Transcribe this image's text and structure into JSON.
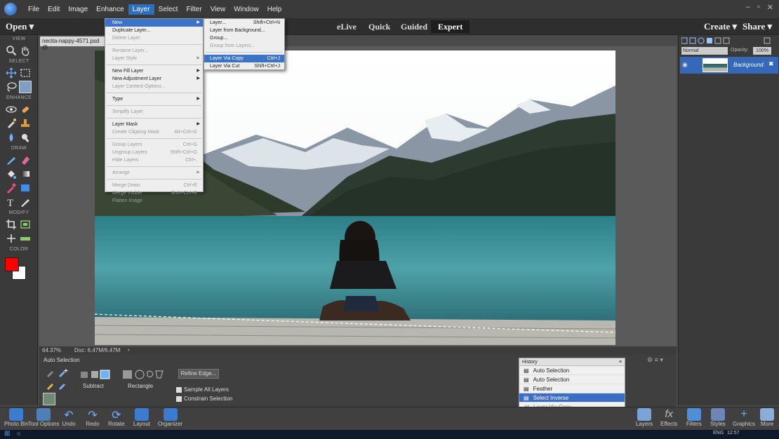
{
  "menubar": {
    "items": [
      "File",
      "Edit",
      "Image",
      "Enhance",
      "Layer",
      "Select",
      "Filter",
      "View",
      "Window",
      "Help"
    ],
    "active": "Layer"
  },
  "modebar": {
    "open": "Open",
    "tabs": [
      "eLive",
      "Quick",
      "Guided",
      "Expert"
    ],
    "active_tab": "Expert",
    "create": "Create",
    "share": "Share"
  },
  "toolbox": {
    "sections": [
      "VIEW",
      "SELECT",
      "ENHANCE",
      "DRAW",
      "MODIFY",
      "COLOR"
    ],
    "foreground_color": "#ff0000",
    "background_color": "#ffffff"
  },
  "document": {
    "tab_title": "necita-nappy-4571.psd @"
  },
  "status": {
    "zoom": "64.37%",
    "doc_size": "Doc: 6.47M/6.47M"
  },
  "tool_options": {
    "tool_name": "Auto Selection",
    "subtract_label": "Subtract",
    "rectangle_label": "Rectangle",
    "refine_edge": "Refine Edge...",
    "sample_all_layers": "Sample All Layers",
    "constrain_selection": "Constrain Selection"
  },
  "layers_panel": {
    "blend_mode": "Normal",
    "opacity_label": "Opacity:",
    "opacity_value": "100%",
    "layer_name": "Background"
  },
  "history": {
    "title": "History",
    "items": [
      "Auto Selection",
      "Auto Selection",
      "Feather",
      "Select Inverse",
      "Layer Via Copy"
    ],
    "selected_index": 3
  },
  "panelbar": {
    "left": [
      "Photo Bin",
      "Tool Options",
      "Undo",
      "Redo",
      "Rotate",
      "Layout",
      "Organizer"
    ],
    "right": [
      "Layers",
      "Effects",
      "Filters",
      "Styles",
      "Graphics",
      "More"
    ]
  },
  "taskbar": {
    "lang": "ENG",
    "time": "12:57"
  },
  "layer_menu": {
    "items": [
      {
        "label": "New",
        "shortcut": "",
        "submenu": true,
        "state": "highlighted"
      },
      {
        "label": "Duplicate Layer...",
        "shortcut": "",
        "submenu": false,
        "state": "normal"
      },
      {
        "label": "Delete Layer",
        "shortcut": "",
        "submenu": false,
        "state": "disabled"
      },
      {
        "sep": true
      },
      {
        "label": "Rename Layer...",
        "shortcut": "",
        "submenu": false,
        "state": "disabled"
      },
      {
        "label": "Layer Style",
        "shortcut": "",
        "submenu": true,
        "state": "disabled"
      },
      {
        "sep": true
      },
      {
        "label": "New Fill Layer",
        "shortcut": "",
        "submenu": true,
        "state": "normal"
      },
      {
        "label": "New Adjustment Layer",
        "shortcut": "",
        "submenu": true,
        "state": "normal"
      },
      {
        "label": "Layer Content Options...",
        "shortcut": "",
        "submenu": false,
        "state": "disabled"
      },
      {
        "sep": true
      },
      {
        "label": "Type",
        "shortcut": "",
        "submenu": true,
        "state": "normal"
      },
      {
        "sep": true
      },
      {
        "label": "Simplify Layer",
        "shortcut": "",
        "submenu": false,
        "state": "disabled"
      },
      {
        "sep": true
      },
      {
        "label": "Layer Mask",
        "shortcut": "",
        "submenu": true,
        "state": "normal"
      },
      {
        "label": "Create Clipping Mask",
        "shortcut": "Alt+Ctrl+G",
        "submenu": false,
        "state": "disabled"
      },
      {
        "sep": true
      },
      {
        "label": "Group Layers",
        "shortcut": "Ctrl+G",
        "submenu": false,
        "state": "disabled"
      },
      {
        "label": "Ungroup Layers",
        "shortcut": "Shift+Ctrl+G",
        "submenu": false,
        "state": "disabled"
      },
      {
        "label": "Hide Layers",
        "shortcut": "Ctrl+,",
        "submenu": false,
        "state": "disabled"
      },
      {
        "sep": true
      },
      {
        "label": "Arrange",
        "shortcut": "",
        "submenu": true,
        "state": "disabled"
      },
      {
        "sep": true
      },
      {
        "label": "Merge Down",
        "shortcut": "Ctrl+E",
        "submenu": false,
        "state": "disabled"
      },
      {
        "label": "Merge Visible",
        "shortcut": "Shift+Ctrl+E",
        "submenu": false,
        "state": "disabled"
      },
      {
        "label": "Flatten Image",
        "shortcut": "",
        "submenu": false,
        "state": "disabled"
      }
    ]
  },
  "new_submenu": {
    "items": [
      {
        "label": "Layer...",
        "shortcut": "Shift+Ctrl+N",
        "state": "normal"
      },
      {
        "label": "Layer from Background...",
        "shortcut": "",
        "state": "normal"
      },
      {
        "label": "Group...",
        "shortcut": "",
        "state": "normal"
      },
      {
        "label": "Group from Layers...",
        "shortcut": "",
        "state": "disabled"
      },
      {
        "sep": true
      },
      {
        "label": "Layer Via Copy",
        "shortcut": "Ctrl+J",
        "state": "highlighted"
      },
      {
        "label": "Layer Via Cut",
        "shortcut": "Shift+Ctrl+J",
        "state": "normal"
      }
    ]
  }
}
